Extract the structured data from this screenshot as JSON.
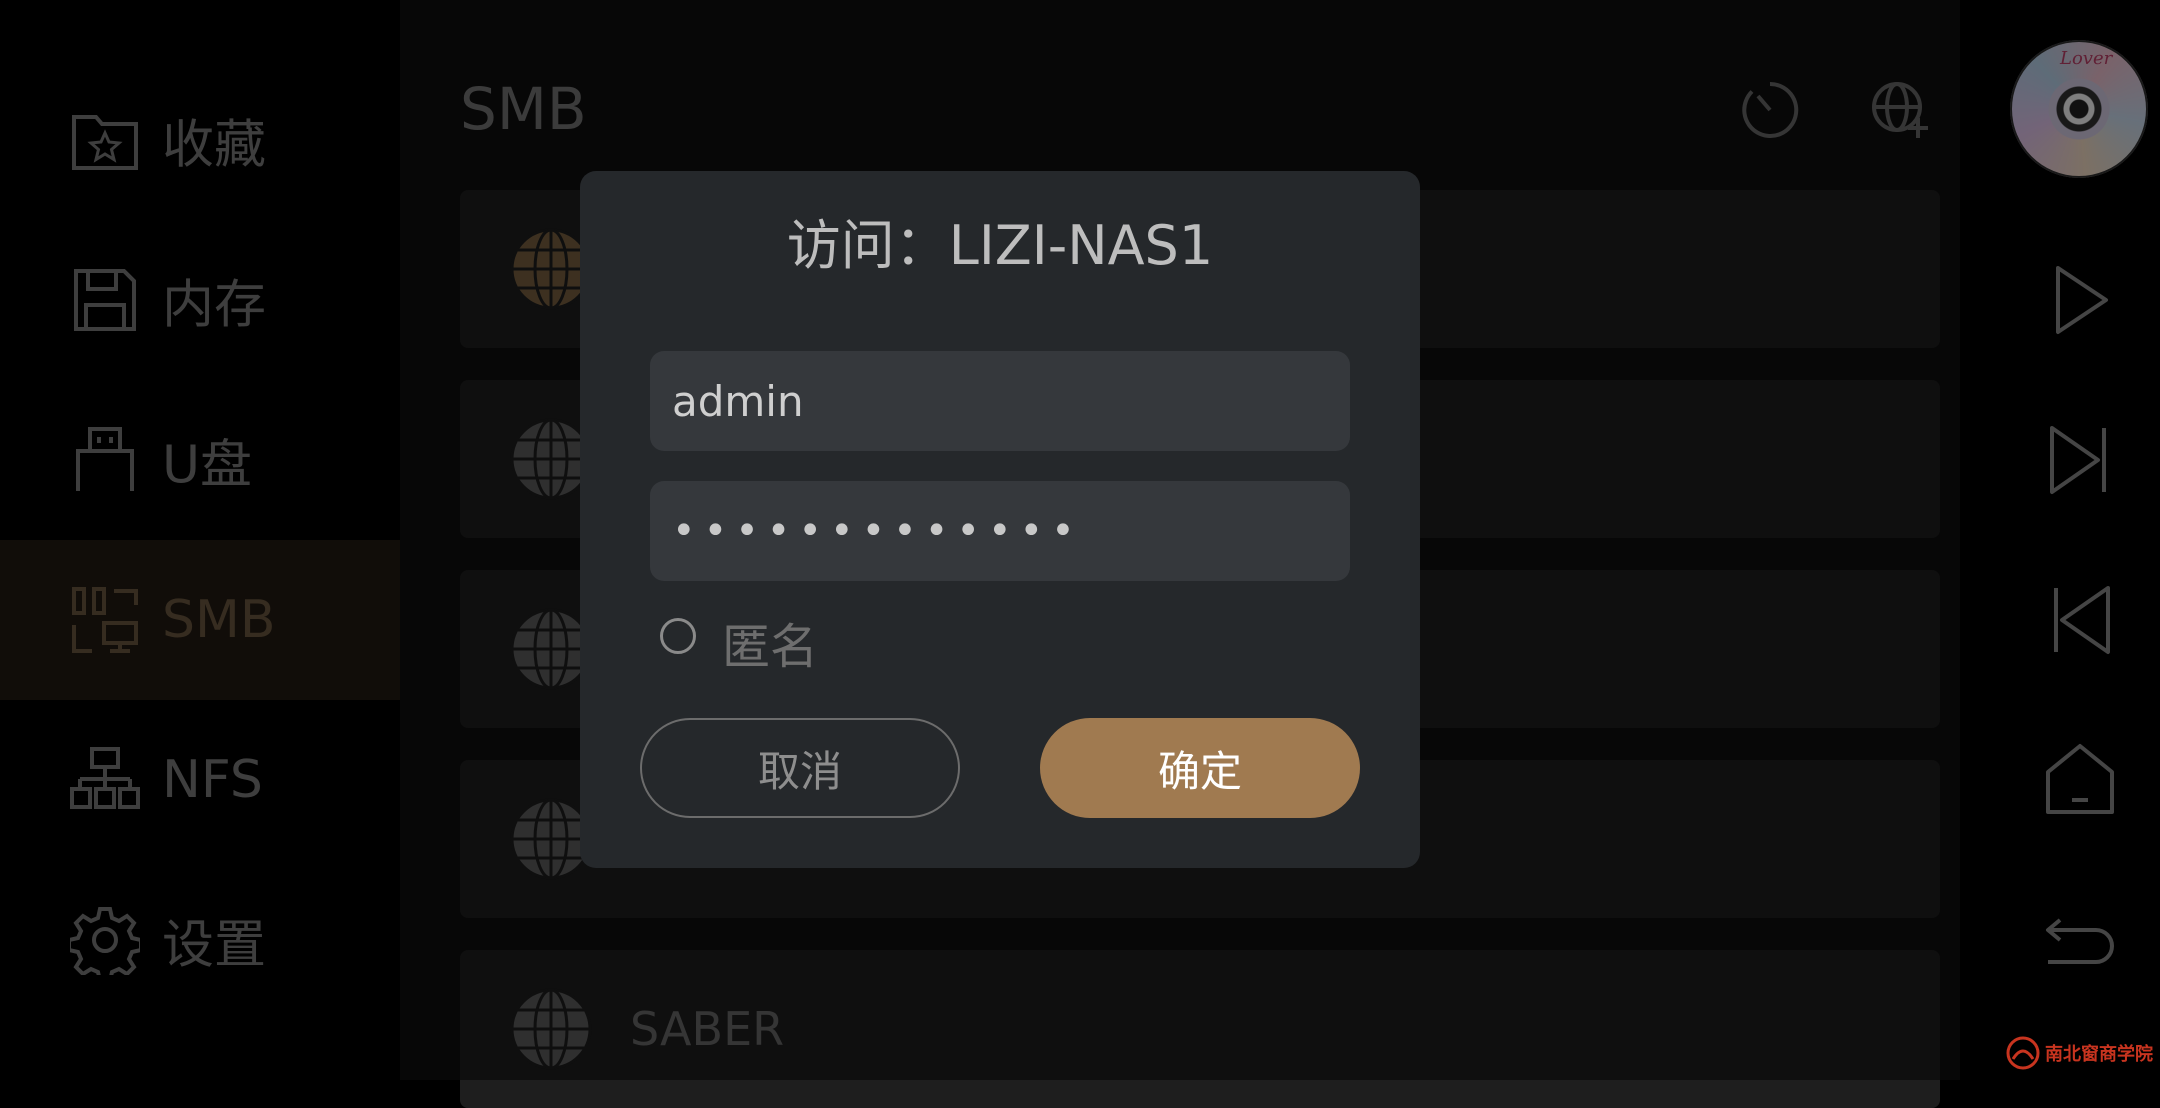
{
  "sidebar": {
    "items": [
      {
        "label": "收藏",
        "icon": "favorite-folder-icon"
      },
      {
        "label": "内存",
        "icon": "save-icon"
      },
      {
        "label": "U盘",
        "icon": "usb-icon"
      },
      {
        "label": "SMB",
        "icon": "smb-icon"
      },
      {
        "label": "NFS",
        "icon": "network-icon"
      },
      {
        "label": "设置",
        "icon": "gear-icon"
      }
    ],
    "active_label": "SMB"
  },
  "main": {
    "title": "SMB",
    "rows": [
      {
        "label": ""
      },
      {
        "label": ""
      },
      {
        "label": ""
      },
      {
        "label": ""
      },
      {
        "label": "SABER"
      }
    ]
  },
  "dialog": {
    "title": "访问：LIZI-NAS1",
    "username_value": "admin",
    "password_value": "•••••••••••••",
    "anonymous_label": "匿名",
    "cancel_label": "取消",
    "confirm_label": "确定"
  },
  "player": {
    "disc_text": "Lover"
  },
  "watermark": {
    "text": "南北窗商学院"
  },
  "colors": {
    "accent": "#a07a50",
    "active_bg": "#221a12",
    "dialog_bg": "#25282b"
  }
}
